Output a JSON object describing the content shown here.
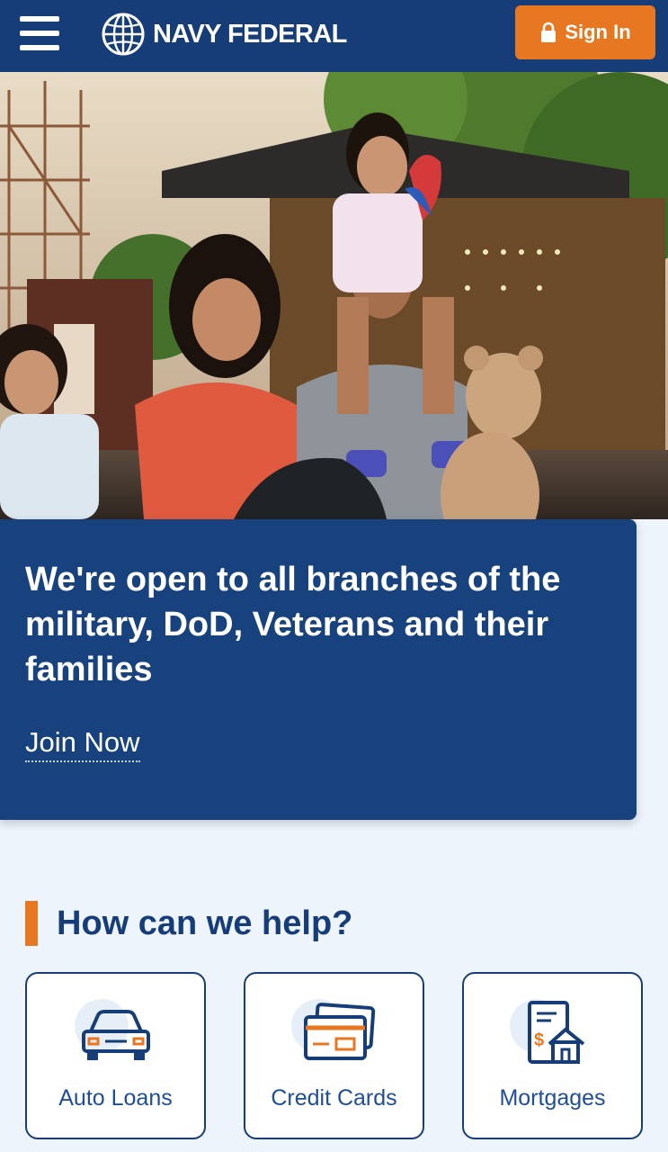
{
  "header": {
    "menu_icon": "hamburger-menu-icon",
    "logo_text": "NAVY FEDERAL",
    "sign_in_label": "Sign In",
    "colors": {
      "header_bg": "#163d78",
      "sign_in_bg": "#e87722"
    }
  },
  "promo": {
    "headline": "We're open to all branches of the military, DoD, Veterans and their families",
    "link_label": "Join Now",
    "bg_color": "#17427e"
  },
  "help": {
    "title": "How can we help?",
    "accent_color": "#e87722",
    "tiles": [
      {
        "label": "Auto Loans",
        "icon": "car-icon"
      },
      {
        "label": "Credit Cards",
        "icon": "credit-card-icon"
      },
      {
        "label": "Mortgages",
        "icon": "mortgage-house-icon"
      }
    ]
  }
}
